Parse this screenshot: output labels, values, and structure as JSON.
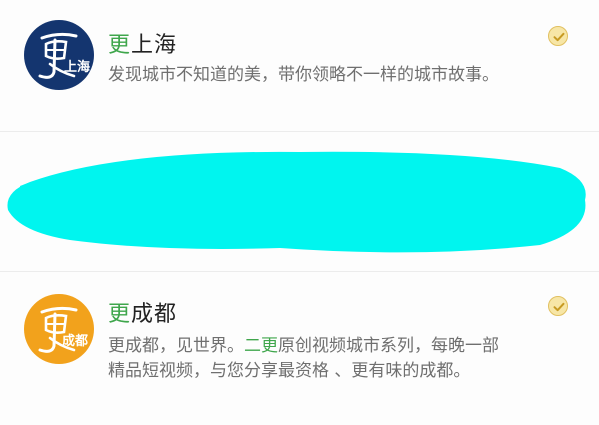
{
  "accounts": [
    {
      "name_accent": "更",
      "name_rest": "上海",
      "logo_text_main": "更",
      "logo_text_sub": "上海",
      "description_line1": "发现城市不知道的美，带你领略不一样的城市故事。",
      "selected": true
    },
    {
      "name_accent": "更",
      "name_rest": "成都",
      "logo_text_main": "更",
      "logo_text_sub": "成都",
      "description_line1_part1": "更成都，见世界。",
      "description_line1_accent": "二更",
      "description_line1_part2": "原创视频城市系列，每晚一部",
      "description_line2": "精品短视频，与您分享最资格 、更有味的成都。",
      "selected": true
    }
  ],
  "colors": {
    "accent_green": "#3fa64c",
    "shanghai_logo_bg": "#14356f",
    "chengdu_logo_bg": "#f2a21c",
    "redaction": "#00f5ef",
    "check_fill": "#f7e6a6",
    "check_stroke": "#c79a22"
  },
  "icons": {
    "selected_check": "check-circle-icon"
  }
}
